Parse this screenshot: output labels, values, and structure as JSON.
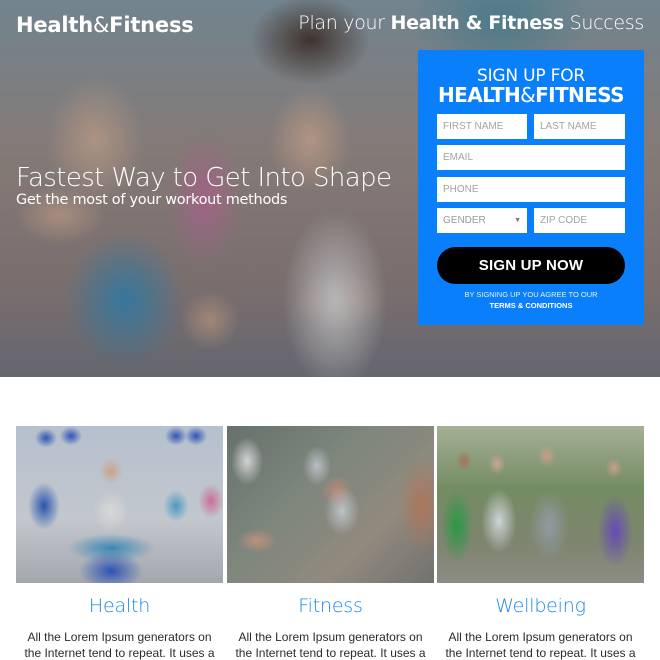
{
  "header": {
    "logo_bold": "Health",
    "logo_amp": "&",
    "logo_bold2": "Fitness",
    "tagline_pre": "Plan your ",
    "tagline_bold": "Health & Fitness",
    "tagline_post": " Success"
  },
  "hero": {
    "title": "Fastest Way to Get Into Shape",
    "subtitle": "Get the most of your workout methods"
  },
  "form": {
    "heading_line1": "SIGN UP FOR",
    "heading_bold1": "HEALTH",
    "heading_amp": "&",
    "heading_bold2": "FITNESS",
    "fields": {
      "first_name": {
        "placeholder": "FIRST NAME",
        "value": ""
      },
      "last_name": {
        "placeholder": "LAST NAME",
        "value": ""
      },
      "email": {
        "placeholder": "EMAIL",
        "value": ""
      },
      "phone": {
        "placeholder": "PHONE",
        "value": ""
      },
      "gender": {
        "selected": "GENDER",
        "caret": "▼"
      },
      "zip": {
        "placeholder": "ZIP CODE",
        "value": ""
      }
    },
    "submit_label": "SIGN UP NOW",
    "disclaimer": "BY SIGNING UP YOU AGREE TO OUR",
    "terms_link": "TERMS & CONDITIONS",
    "accent_color": "#0a7ffb",
    "button_color": "#000000"
  },
  "features": [
    {
      "title": "Health",
      "image": "group-yoga-class-photo",
      "text": "All the Lorem Ipsum generators on the Internet tend to repeat. It uses a"
    },
    {
      "title": "Fitness",
      "image": "dumbbell-lifting-photo",
      "text": "All the Lorem Ipsum generators on the Internet tend to repeat. It uses a"
    },
    {
      "title": "Wellbeing",
      "image": "group-of-adults-outdoors-photo",
      "text": "All the Lorem Ipsum generators on the Internet tend to repeat. It uses a"
    }
  ],
  "colors": {
    "feature_title": "#1a86f2",
    "body_text": "#2b2b2b"
  }
}
